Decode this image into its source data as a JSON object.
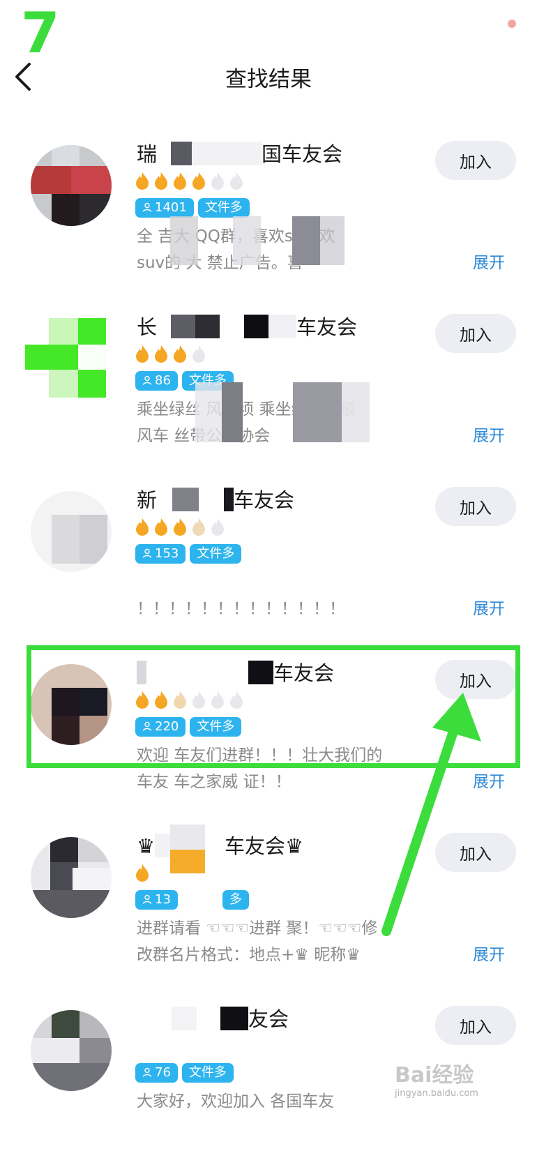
{
  "step_badge": "7",
  "header": {
    "title": "查找结果",
    "back_icon": "chevron-left-icon"
  },
  "colors": {
    "accent_green": "#3ddc3d",
    "tag_blue": "#2db4ee",
    "link_blue": "#2d8ad8",
    "flame_orange": "#f5a623"
  },
  "groups": [
    {
      "name_prefix": "瑞",
      "name_suffix": "国车友会",
      "flames_lit": 4,
      "flames_total": 6,
      "members": "1401",
      "tag": "文件多",
      "desc_line1": "  全     吉大        QQ群，喜欢s3喜欢",
      "desc_line2": "suv的    大         禁止广告。喜",
      "expand_label": "展开",
      "join_label": "加入"
    },
    {
      "name_prefix": "长",
      "name_suffix": "车友会",
      "flames_lit": 3,
      "flames_total": 4,
      "members": "86",
      "tag": "文件多",
      "desc_line1": "乘坐绿丝     风车须          乘坐绿丝带顺",
      "desc_line2": "风车             丝带公益协会",
      "expand_label": "展开",
      "join_label": "加入"
    },
    {
      "name_prefix": "新",
      "name_suffix": "车友会",
      "flames_lit": 3,
      "flames_total": 5,
      "members": "153",
      "tag": "文件多",
      "desc_line1": "",
      "desc_line2": "                    ！！！！！！！！！！！！！",
      "expand_label": "展开",
      "join_label": "加入"
    },
    {
      "name_prefix": "",
      "name_suffix": "车友会",
      "flames_lit": 2,
      "flames_total": 6,
      "members": "220",
      "tag": "文件多",
      "desc_line1": "欢迎       车友们进群！！！壮大我们的",
      "desc_line2": "车友       车之家威    证！！",
      "expand_label": "展开",
      "join_label": "加入"
    },
    {
      "name_prefix": "♛",
      "name_suffix": "车友会♛",
      "flames_lit": 1,
      "flames_total": 1,
      "members": "13",
      "tag": "多",
      "desc_line1": "进群请看 ☜☜☜进群   聚！☜☜☜修",
      "desc_line2": "改群名片格式：地点+♛      昵称♛",
      "expand_label": "展开",
      "join_label": "加入"
    },
    {
      "name_prefix": "",
      "name_suffix": "友会",
      "flames_lit": 0,
      "flames_total": 0,
      "members": "76",
      "tag": "文件多",
      "desc_line1": "  大家好，欢迎加入  各国车友",
      "desc_line2": "",
      "expand_label": "",
      "join_label": "加入"
    }
  ],
  "watermark": {
    "text": "Bai经验",
    "sub": "jingyan.baidu.com"
  }
}
